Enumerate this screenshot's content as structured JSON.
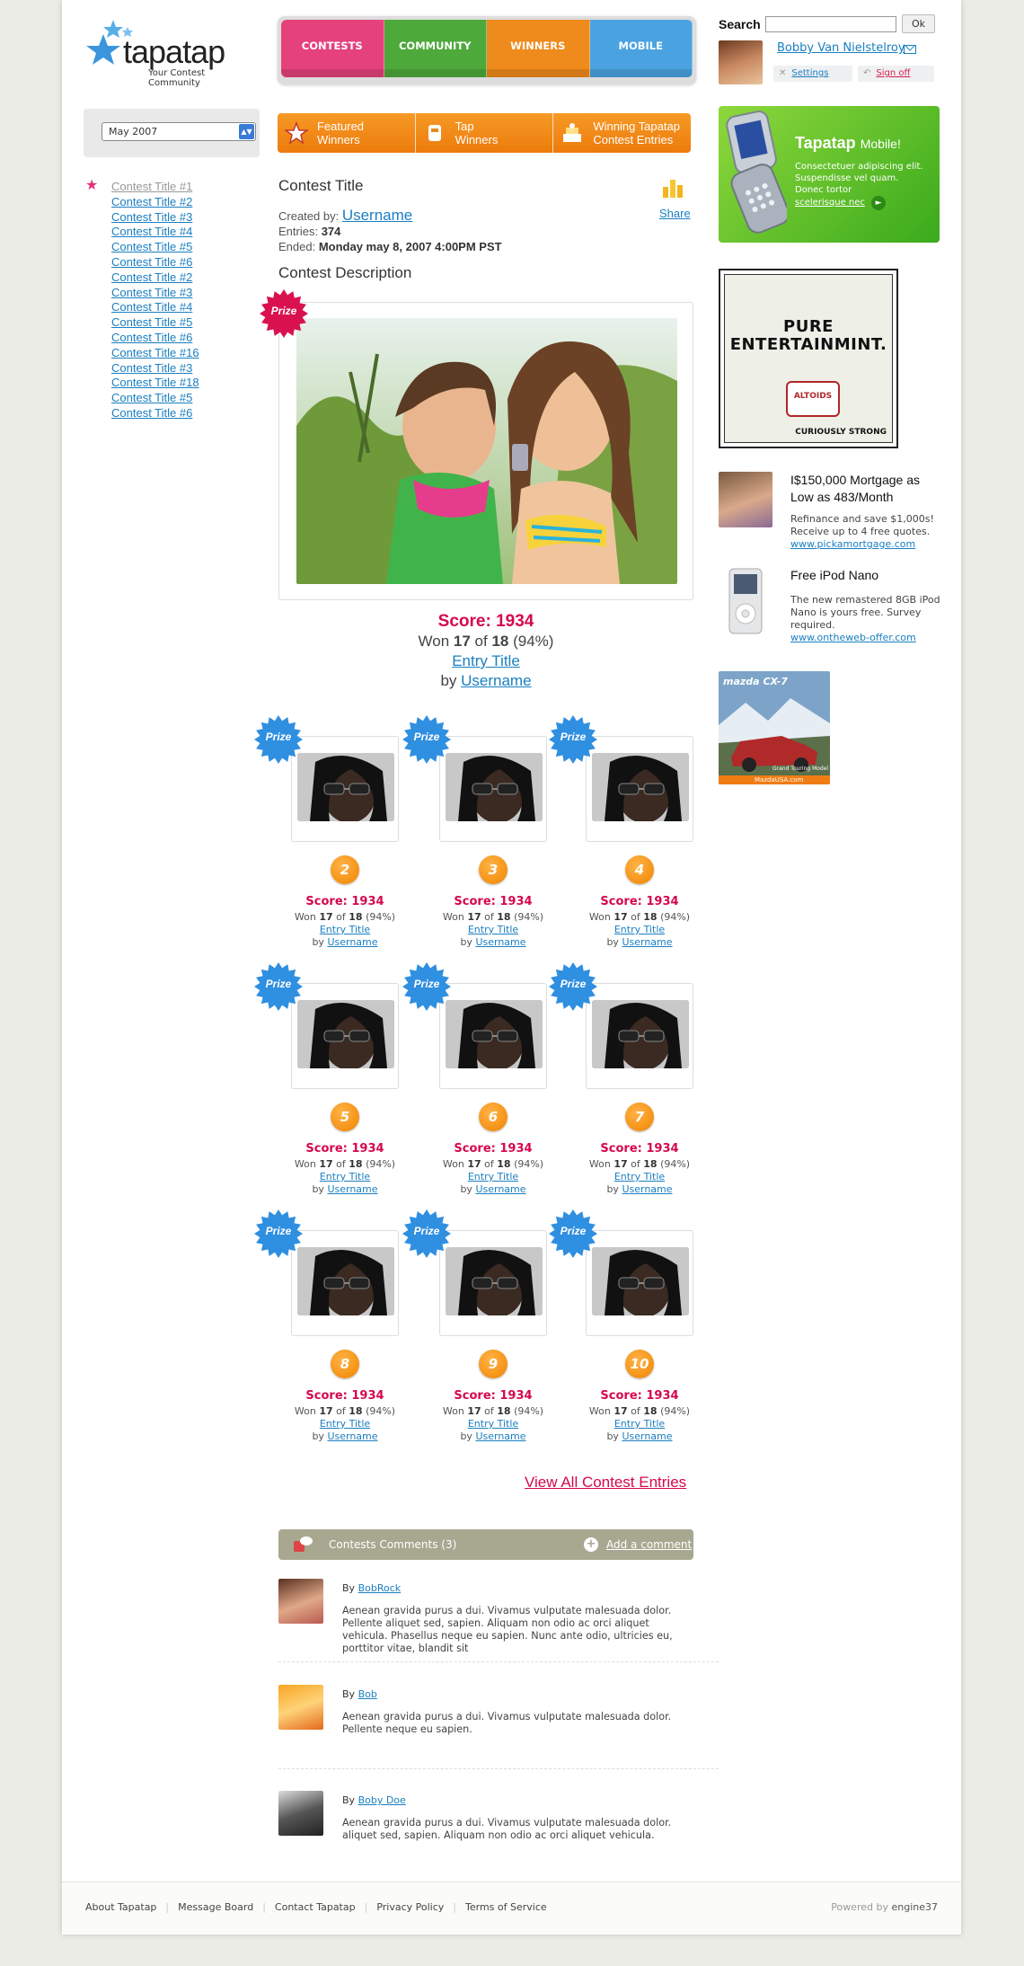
{
  "logo": {
    "word": "tapatap",
    "tagline": "Your Contest Community"
  },
  "nav": {
    "tabs": [
      {
        "label": "CONTESTS",
        "color": "#e5427c"
      },
      {
        "label": "COMMUNITY",
        "color": "#4ea93b"
      },
      {
        "label": "WINNERS",
        "color": "#ef8a1c"
      },
      {
        "label": "MOBILE",
        "color": "#4aa3e0"
      }
    ]
  },
  "search": {
    "label": "Search",
    "value": "",
    "button": "Ok"
  },
  "user": {
    "name": "Bobby Van Nielstelroy",
    "settings": "Settings",
    "signout": "Sign off"
  },
  "month": {
    "selected": "May 2007"
  },
  "winners_bar": {
    "items": [
      {
        "line1": "Featured",
        "line2": "Winners"
      },
      {
        "line1": "Tap",
        "line2": "Winners"
      },
      {
        "line1": "Winning Tapatap",
        "line2": "Contest Entries"
      }
    ]
  },
  "mobile_ad": {
    "brand": "Tapatap",
    "suffix": "Mobile!",
    "desc": "Consectetuer adipiscing elit. Suspendisse vel quam. Donec tortor",
    "link": "scelerisque nec"
  },
  "sidebar": {
    "items": [
      "Contest Title #1",
      "Contest Title #2",
      "Contest Title #3",
      "Contest Title #4",
      "Contest Title #5",
      "Contest Title #6",
      "Contest Title #2",
      "Contest Title #3",
      "Contest Title #4",
      "Contest Title #5",
      "Contest Title #6",
      "Contest Title #16",
      "Contest Title #3",
      "Contest Title #18",
      "Contest Title #5",
      "Contest Title #6"
    ]
  },
  "contest": {
    "title": "Contest Title",
    "created_label": "Created by:",
    "creator": "Username",
    "entries_label": "Entries:",
    "entries": "374",
    "ended_label": "Ended:",
    "ended": "Monday may 8, 2007 4:00PM PST",
    "description_heading": "Contest Description",
    "share": "Share"
  },
  "prize_label": "Prize",
  "winner": {
    "score": "Score: 1934",
    "won_a": "Won ",
    "won_n": "17",
    "won_b": " of ",
    "won_m": "18",
    "won_pct": " (94%)",
    "entry_title": "Entry Title",
    "by": "by ",
    "username": "Username"
  },
  "entries": [
    {
      "rank": "2",
      "score": "Score: 1934",
      "won": "17",
      "of": "18",
      "pct": "(94%)",
      "title": "Entry Title",
      "user": "Username"
    },
    {
      "rank": "3",
      "score": "Score: 1934",
      "won": "17",
      "of": "18",
      "pct": "(94%)",
      "title": "Entry Title",
      "user": "Username"
    },
    {
      "rank": "4",
      "score": "Score: 1934",
      "won": "17",
      "of": "18",
      "pct": "(94%)",
      "title": "Entry Title",
      "user": "Username"
    },
    {
      "rank": "5",
      "score": "Score: 1934",
      "won": "17",
      "of": "18",
      "pct": "(94%)",
      "title": "Entry Title",
      "user": "Username"
    },
    {
      "rank": "6",
      "score": "Score: 1934",
      "won": "17",
      "of": "18",
      "pct": "(94%)",
      "title": "Entry Title",
      "user": "Username"
    },
    {
      "rank": "7",
      "score": "Score: 1934",
      "won": "17",
      "of": "18",
      "pct": "(94%)",
      "title": "Entry Title",
      "user": "Username"
    },
    {
      "rank": "8",
      "score": "Score: 1934",
      "won": "17",
      "of": "18",
      "pct": "(94%)",
      "title": "Entry Title",
      "user": "Username"
    },
    {
      "rank": "9",
      "score": "Score: 1934",
      "won": "17",
      "of": "18",
      "pct": "(94%)",
      "title": "Entry Title",
      "user": "Username"
    },
    {
      "rank": "10",
      "score": "Score: 1934",
      "won": "17",
      "of": "18",
      "pct": "(94%)",
      "title": "Entry Title",
      "user": "Username"
    }
  ],
  "view_all": "View All Contest Entries",
  "comments": {
    "header": "Contests Comments (3)",
    "add": "Add a comment",
    "items": [
      {
        "by": "By ",
        "user": "BobRock",
        "text": "Aenean gravida purus a dui. Vivamus vulputate malesuada dolor. Pellente aliquet sed, sapien. Aliquam non odio ac orci aliquet vehicula. Phasellus neque eu sapien. Nunc ante odio, ultricies eu, porttitor vitae, blandit sit"
      },
      {
        "by": "By ",
        "user": "Bob",
        "text": "Aenean gravida purus a dui. Vivamus vulputate malesuada dolor. Pellente neque eu sapien."
      },
      {
        "by": "By ",
        "user": "Boby Doe",
        "text": "Aenean gravida purus a dui. Vivamus vulputate malesuada dolor. aliquet sed, sapien. Aliquam non odio ac orci aliquet vehicula."
      }
    ]
  },
  "ads": {
    "altoids": {
      "line1": "PURE",
      "line2": "ENTERTAINMINT.",
      "tin": "ALTOIDS",
      "tagline": "CURIOUSLY STRONG"
    },
    "mortgage": {
      "title": "I$150,000 Mortgage as Low as 483/Month",
      "desc": "Refinance and save $1,000s! Receive up to 4 free quotes.",
      "link": "www.pickamortgage.com"
    },
    "ipod": {
      "title": "Free iPod Nano",
      "desc": "The new remastered 8GB iPod Nano is yours free. Survey required.",
      "link": "www.ontheweb-offer.com"
    },
    "mazda": {
      "brand": "mazda",
      "model": "CX-7",
      "sub": "Grand Touring Model",
      "url": "MazdaUSA.com"
    }
  },
  "footer": {
    "links": [
      "About Tapatap",
      "Message Board",
      "Contact Tapatap",
      "Privacy Policy",
      "Terms of Service"
    ],
    "powered": "Powered by ",
    "brand": "engine37"
  }
}
